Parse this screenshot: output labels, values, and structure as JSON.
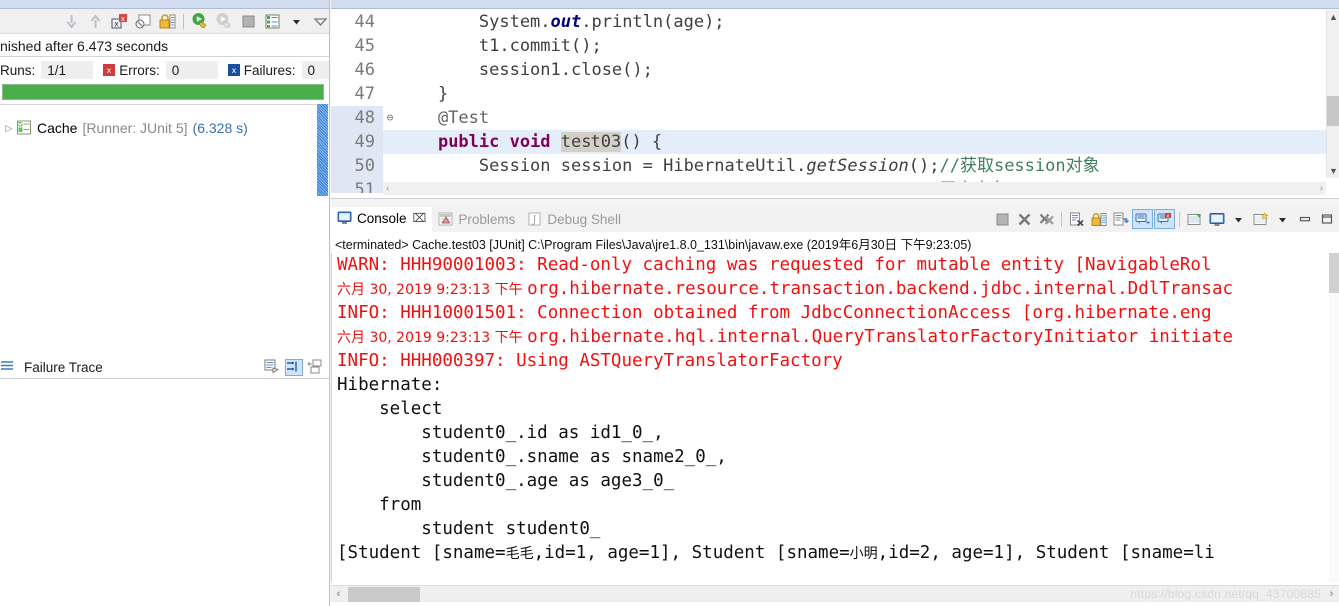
{
  "app": {
    "watermark": "https://blog.csdn.net/qq_43700885"
  },
  "junit_view": {
    "toolbar": [
      {
        "name": "next-failure-icon",
        "glyph": "⇩"
      },
      {
        "name": "previous-failure-icon",
        "glyph": "⇧"
      },
      {
        "name": "show-failures-only-icon",
        "glyph": "✕"
      },
      {
        "name": "show-ignored-only-icon",
        "glyph": "⊘"
      },
      {
        "name": "scroll-lock-icon",
        "glyph": "🔒"
      },
      {
        "name": "rerun-test-icon",
        "glyph": "▶"
      },
      {
        "name": "rerun-test-failures-icon",
        "glyph": "▷"
      },
      {
        "name": "stop-icon",
        "glyph": "■"
      },
      {
        "name": "test-run-history-icon",
        "glyph": "≣"
      },
      {
        "name": "view-menu-dropdown-icon",
        "glyph": "▼"
      },
      {
        "name": "view-menu-icon",
        "glyph": "▽"
      }
    ],
    "status_text": "nished after 6.473 seconds",
    "counters": [
      {
        "label": "Runs:",
        "value": "1/1",
        "icon": ""
      },
      {
        "label": "Errors:",
        "value": "0",
        "icon": "errors-icon"
      },
      {
        "label": "Failures:",
        "value": "0",
        "icon": "failures-icon"
      }
    ],
    "progress": {
      "percent": 100,
      "color": "#4aaf4a"
    },
    "tree": {
      "arrow": "▷",
      "icon_name": "test-suite-icon",
      "name": "Cache",
      "runner": "[Runner: JUnit 5]",
      "time": "(6.328 s)"
    },
    "failure_trace": {
      "label": "Failure Trace",
      "tools": [
        {
          "name": "compare-result-icon"
        },
        {
          "name": "filter-stack-trace-icon",
          "active": true
        },
        {
          "name": "view-menu-icon"
        }
      ]
    }
  },
  "editor": {
    "lines": [
      {
        "num": "44",
        "fold": "",
        "marked": false,
        "selected": false,
        "segments": [
          {
            "text": "        System.",
            "cls": "cls"
          },
          {
            "text": "out",
            "cls": "kw2"
          },
          {
            "text": ".println(age);",
            "cls": "cls"
          }
        ]
      },
      {
        "num": "45",
        "fold": "",
        "marked": false,
        "selected": false,
        "segments": [
          {
            "text": "        t1.commit();",
            "cls": "cls"
          }
        ]
      },
      {
        "num": "46",
        "fold": "",
        "marked": false,
        "selected": false,
        "segments": [
          {
            "text": "        session1.close();",
            "cls": "cls"
          }
        ]
      },
      {
        "num": "47",
        "fold": "",
        "marked": false,
        "selected": false,
        "segments": [
          {
            "text": "    }",
            "cls": "cls"
          }
        ]
      },
      {
        "num": "48",
        "fold": "⊖",
        "marked": true,
        "selected": false,
        "segments": [
          {
            "text": "    @Test",
            "cls": "ann"
          }
        ]
      },
      {
        "num": "49",
        "fold": "",
        "marked": true,
        "selected": true,
        "segments": [
          {
            "text": "    ",
            "cls": "cls"
          },
          {
            "text": "public void ",
            "cls": "kw"
          },
          {
            "text": "tes",
            "cls": "sel-token"
          },
          {
            "text": "t03",
            "cls": "sel-token"
          },
          {
            "text": "() {",
            "cls": "cls"
          }
        ]
      },
      {
        "num": "50",
        "fold": "",
        "marked": true,
        "selected": false,
        "segments": [
          {
            "text": "        Session session = HibernateUtil.",
            "cls": "cls"
          },
          {
            "text": "getSession",
            "cls": "mth"
          },
          {
            "text": "();",
            "cls": "cls"
          },
          {
            "text": "//获取session对象",
            "cls": "cmt"
          }
        ]
      },
      {
        "num": "51",
        "fold": "",
        "marked": true,
        "selected": false,
        "segments": [
          {
            "text": "        Transaction t = session.beginTransaction();",
            "cls": "cls"
          },
          {
            "text": "//开启事务",
            "cls": "cmt"
          }
        ]
      }
    ],
    "hscroll": {
      "left_arrow": "‹",
      "right_arrow": "›"
    },
    "vscroll": {
      "up_arrow": "▲",
      "down_arrow": "▼"
    }
  },
  "console": {
    "tabs": [
      {
        "label": "Console",
        "icon": "console-icon",
        "active": true,
        "close": "⌧"
      },
      {
        "label": "Problems",
        "icon": "problems-icon",
        "active": false
      },
      {
        "label": "Debug Shell",
        "icon": "debug-shell-icon",
        "active": false
      }
    ],
    "toolbar": [
      {
        "name": "terminate-icon",
        "glyph": "■"
      },
      {
        "name": "remove-launch-icon",
        "glyph": "✖"
      },
      {
        "name": "remove-all-terminated-icon",
        "glyph": "✖"
      },
      {
        "name": "sep",
        "glyph": ""
      },
      {
        "name": "clear-console-icon",
        "glyph": "⌧"
      },
      {
        "name": "scroll-lock-icon",
        "glyph": "🔒"
      },
      {
        "name": "word-wrap-icon",
        "glyph": "↵"
      },
      {
        "name": "show-console-on-output-icon",
        "glyph": "⬚",
        "toggled": true
      },
      {
        "name": "show-console-on-error-icon",
        "glyph": "⬚",
        "toggled": true
      },
      {
        "name": "sep2",
        "glyph": ""
      },
      {
        "name": "pin-console-icon",
        "glyph": "📌"
      },
      {
        "name": "display-selected-console-icon",
        "glyph": "▣"
      },
      {
        "name": "display-selected-console-dropdown-icon",
        "glyph": "▾"
      },
      {
        "name": "open-console-icon",
        "glyph": "⬚"
      },
      {
        "name": "open-console-dropdown-icon",
        "glyph": "▾"
      },
      {
        "name": "minimize-icon",
        "glyph": "▁"
      },
      {
        "name": "maximize-icon",
        "glyph": "□"
      }
    ],
    "terminated_line": "<terminated> Cache.test03 [JUnit] C:\\Program Files\\Java\\jre1.8.0_131\\bin\\javaw.exe (2019年6月30日 下午9:23:05)",
    "output": [
      {
        "color": "red",
        "parts": [
          {
            "t": "WARN: HHH90001003: Read-only caching was requested for mutable entity [NavigableRol",
            "cjk": false
          }
        ]
      },
      {
        "color": "red",
        "parts": [
          {
            "t": "六月 30, 2019 9:23:13 下午 ",
            "cjk": true
          },
          {
            "t": "org.hibernate.resource.transaction.backend.jdbc.internal.DdlTransac",
            "cjk": false
          }
        ]
      },
      {
        "color": "red",
        "parts": [
          {
            "t": "INFO: HHH10001501: Connection obtained from JdbcConnectionAccess [org.hibernate.eng",
            "cjk": false
          }
        ]
      },
      {
        "color": "red",
        "parts": [
          {
            "t": "六月 30, 2019 9:23:13 下午 ",
            "cjk": true
          },
          {
            "t": "org.hibernate.hql.internal.QueryTranslatorFactoryInitiator initiate",
            "cjk": false
          }
        ]
      },
      {
        "color": "red",
        "parts": [
          {
            "t": "INFO: HHH000397: Using ASTQueryTranslatorFactory",
            "cjk": false
          }
        ]
      },
      {
        "color": "black",
        "parts": [
          {
            "t": "Hibernate: ",
            "cjk": false
          }
        ]
      },
      {
        "color": "black",
        "parts": [
          {
            "t": "    select",
            "cjk": false
          }
        ]
      },
      {
        "color": "black",
        "parts": [
          {
            "t": "        student0_.id as id1_0_,",
            "cjk": false
          }
        ]
      },
      {
        "color": "black",
        "parts": [
          {
            "t": "        student0_.sname as sname2_0_,",
            "cjk": false
          }
        ]
      },
      {
        "color": "black",
        "parts": [
          {
            "t": "        student0_.age as age3_0_",
            "cjk": false
          }
        ]
      },
      {
        "color": "black",
        "parts": [
          {
            "t": "    from",
            "cjk": false
          }
        ]
      },
      {
        "color": "black",
        "parts": [
          {
            "t": "        student student0_",
            "cjk": false
          }
        ]
      },
      {
        "color": "black",
        "parts": [
          {
            "t": "[Student [sname=",
            "cjk": false
          },
          {
            "t": "毛毛",
            "cjk": true
          },
          {
            "t": ",id=1, age=1], Student [sname=",
            "cjk": false
          },
          {
            "t": "小明",
            "cjk": true
          },
          {
            "t": ",id=2, age=1], Student [sname=li",
            "cjk": false
          }
        ]
      }
    ],
    "hscroll": {
      "left_arrow": "‹",
      "right_arrow": "›"
    }
  }
}
